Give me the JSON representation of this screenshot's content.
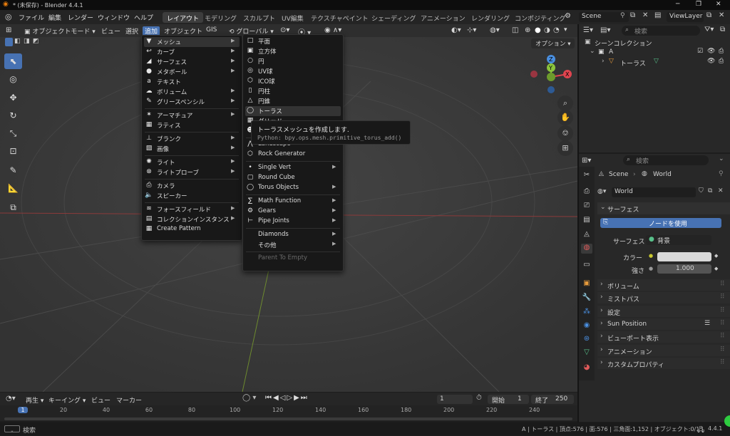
{
  "window": {
    "title": "* (未保存) - Blender 4.4.1"
  },
  "topmenu": [
    "ファイル",
    "編集",
    "レンダー",
    "ウィンドウ",
    "ヘルプ"
  ],
  "workspaces": [
    "レイアウト",
    "モデリング",
    "スカルプト",
    "UV編集",
    "テクスチャペイント",
    "シェーディング",
    "アニメーション",
    "レンダリング",
    "コンポジティング"
  ],
  "scene": {
    "name": "Scene",
    "viewlayer": "ViewLayer"
  },
  "viewport_header": {
    "mode": "オブジェクトモード",
    "view": "ビュー",
    "select": "選択",
    "add": "追加",
    "object": "オブジェクト",
    "gis": "GIS",
    "transform": "グローバル",
    "options": "オプション"
  },
  "add_menu": [
    {
      "label": "メッシュ",
      "icon": "mesh-icon",
      "sub": true,
      "hl": true
    },
    {
      "label": "カーブ",
      "icon": "curve-icon",
      "sub": true
    },
    {
      "label": "サーフェス",
      "icon": "surface-icon",
      "sub": true
    },
    {
      "label": "メタボール",
      "icon": "metaball-icon",
      "sub": true
    },
    {
      "label": "テキスト",
      "icon": "text-icon",
      "sub": false
    },
    {
      "label": "ボリューム",
      "icon": "volume-icon",
      "sub": true
    },
    {
      "label": "グリースペンシル",
      "icon": "grease-pencil-icon",
      "sub": true
    },
    {
      "label": "アーマチュア",
      "icon": "armature-icon",
      "sub": true
    },
    {
      "label": "ラティス",
      "icon": "lattice-icon",
      "sub": false
    },
    {
      "label": "ブランク",
      "icon": "empty-icon",
      "sub": true
    },
    {
      "label": "画像",
      "icon": "image-icon",
      "sub": true
    },
    {
      "label": "ライト",
      "icon": "light-icon",
      "sub": true
    },
    {
      "label": "ライトプローブ",
      "icon": "light-probe-icon",
      "sub": true
    },
    {
      "label": "カメラ",
      "icon": "camera-icon",
      "sub": false
    },
    {
      "label": "スピーカー",
      "icon": "speaker-icon",
      "sub": false
    },
    {
      "label": "フォースフィールド",
      "icon": "force-field-icon",
      "sub": true
    },
    {
      "label": "コレクションインスタンス",
      "icon": "collection-icon",
      "sub": true
    },
    {
      "label": "Create Pattern",
      "icon": "pattern-icon",
      "sub": false
    }
  ],
  "mesh_menu": [
    {
      "label": "平面",
      "icon": "plane-icon",
      "sub": false
    },
    {
      "label": "立方体",
      "icon": "cube-icon",
      "sub": false
    },
    {
      "label": "円",
      "icon": "circle-icon",
      "sub": false
    },
    {
      "label": "UV球",
      "icon": "uv-sphere-icon",
      "sub": false
    },
    {
      "label": "ICO球",
      "icon": "ico-sphere-icon",
      "sub": false
    },
    {
      "label": "円柱",
      "icon": "cylinder-icon",
      "sub": false
    },
    {
      "label": "円錐",
      "icon": "cone-icon",
      "sub": false
    },
    {
      "label": "トーラス",
      "icon": "torus-icon",
      "sub": false,
      "hl": true
    },
    {
      "label": "グリッド",
      "icon": "grid-icon",
      "sub": false
    },
    {
      "label": "モンキー",
      "icon": "monkey-icon",
      "sub": false
    },
    {
      "label": "Landscape",
      "icon": "landscape-icon",
      "sub": false
    },
    {
      "label": "Rock Generator",
      "icon": "rock-icon",
      "sub": false
    },
    {
      "label": "Single Vert",
      "icon": "vert-icon",
      "sub": true
    },
    {
      "label": "Round Cube",
      "icon": "round-cube-icon",
      "sub": false
    },
    {
      "label": "Torus Objects",
      "icon": "torus-objects-icon",
      "sub": true
    },
    {
      "label": "Math Function",
      "icon": "math-icon",
      "sub": true
    },
    {
      "label": "Gears",
      "icon": "gear-icon",
      "sub": true
    },
    {
      "label": "Pipe Joints",
      "icon": "pipe-icon",
      "sub": true
    },
    {
      "label": "Diamonds",
      "icon": "",
      "sub": true
    },
    {
      "label": "その他",
      "icon": "",
      "sub": true
    },
    {
      "label": "Parent To Empty",
      "icon": "",
      "sub": false,
      "disabled": true
    }
  ],
  "tooltip": {
    "title": "トーラスメッシュを作成します.",
    "python": "Python: bpy.ops.mesh.primitive_torus_add()"
  },
  "outliner": {
    "search": "検索",
    "root": "シーンコレクション",
    "collection": "A",
    "object": "トーラス"
  },
  "properties": {
    "search": "検索",
    "breadcrumb_scene": "Scene",
    "breadcrumb_world": "World",
    "world_name": "World",
    "surface_section": "サーフェス",
    "use_nodes": "ノードを使用",
    "surface_label": "サーフェス",
    "surface_value": "背景",
    "color_label": "カラー",
    "strength_label": "強さ",
    "strength_value": "1.000",
    "sections": [
      "ボリューム",
      "ミストパス",
      "設定",
      "Sun Position",
      "ビューポート表示",
      "アニメーション",
      "カスタムプロパティ"
    ]
  },
  "timeline": {
    "play": "再生",
    "keying": "キーイング",
    "view": "ビュー",
    "marker": "マーカー",
    "current": "1",
    "start_label": "開始",
    "start": "1",
    "end_label": "終了",
    "end": "250",
    "frames": [
      "1",
      "20",
      "40",
      "60",
      "80",
      "100",
      "120",
      "140",
      "160",
      "180",
      "200",
      "220",
      "240"
    ]
  },
  "status": {
    "hint": "検索",
    "info": "A | トーラス | 頂点:576 | 面:576 | 三角面:1,152 | オブジェクト:0/1 |",
    "version": "4.4.1"
  },
  "colors": {
    "accent": "#4772b3",
    "x_axis": "#e0444f",
    "y_axis": "#8cc43c",
    "z_axis": "#4a8fe0"
  }
}
